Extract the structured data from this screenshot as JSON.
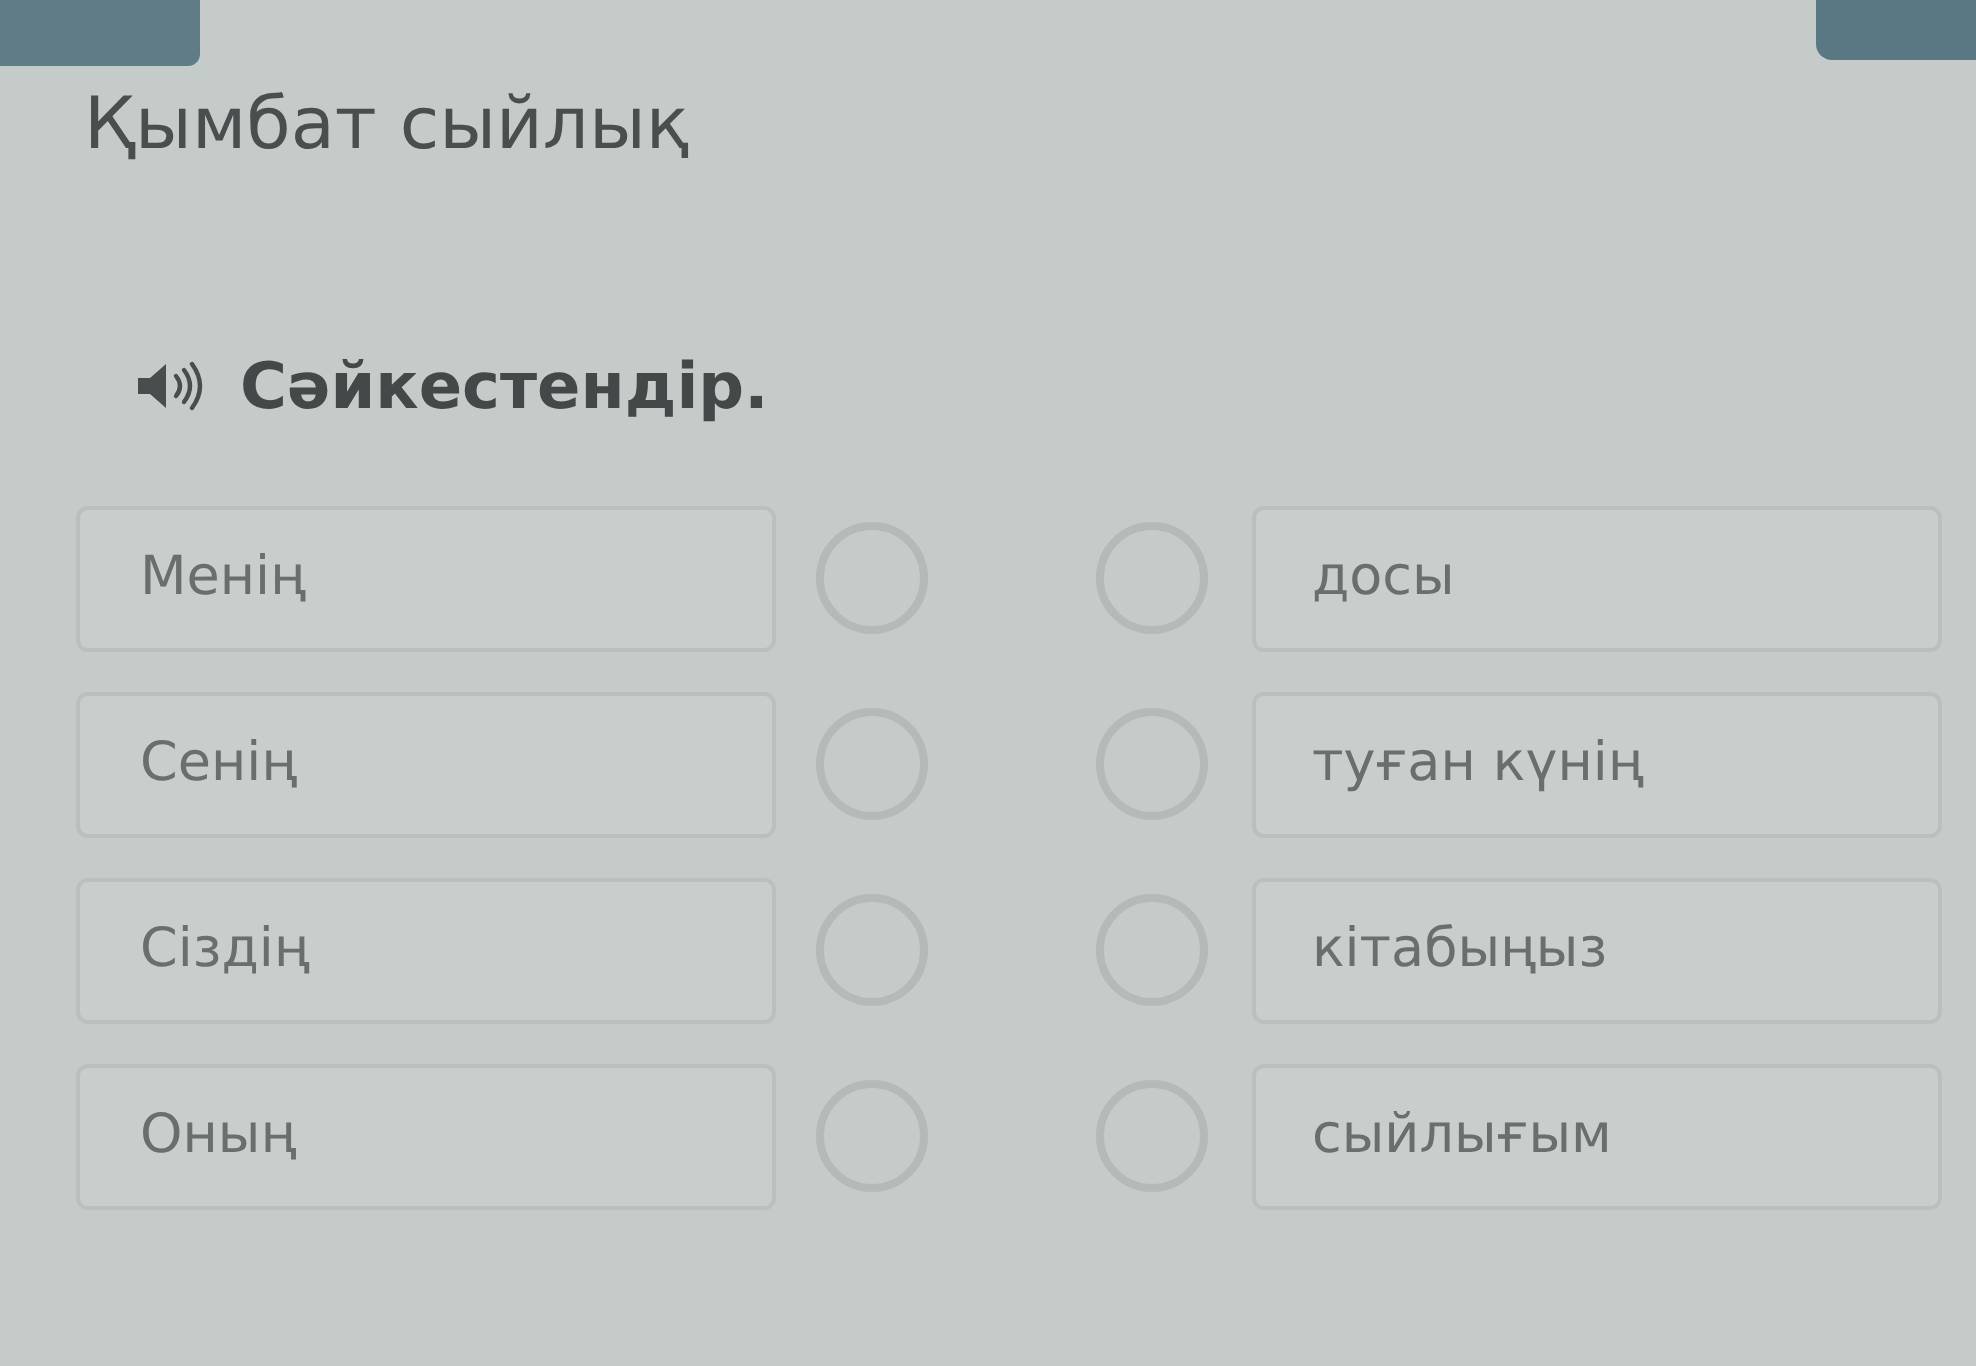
{
  "title": "Қымбат сыйлық",
  "instruction": "Сәйкестендір.",
  "left_items": [
    "Менің",
    "Сенің",
    "Сіздің",
    "Оның"
  ],
  "right_items": [
    "досы",
    "туған күнің",
    "кітабыңыз",
    "сыйлығым"
  ]
}
